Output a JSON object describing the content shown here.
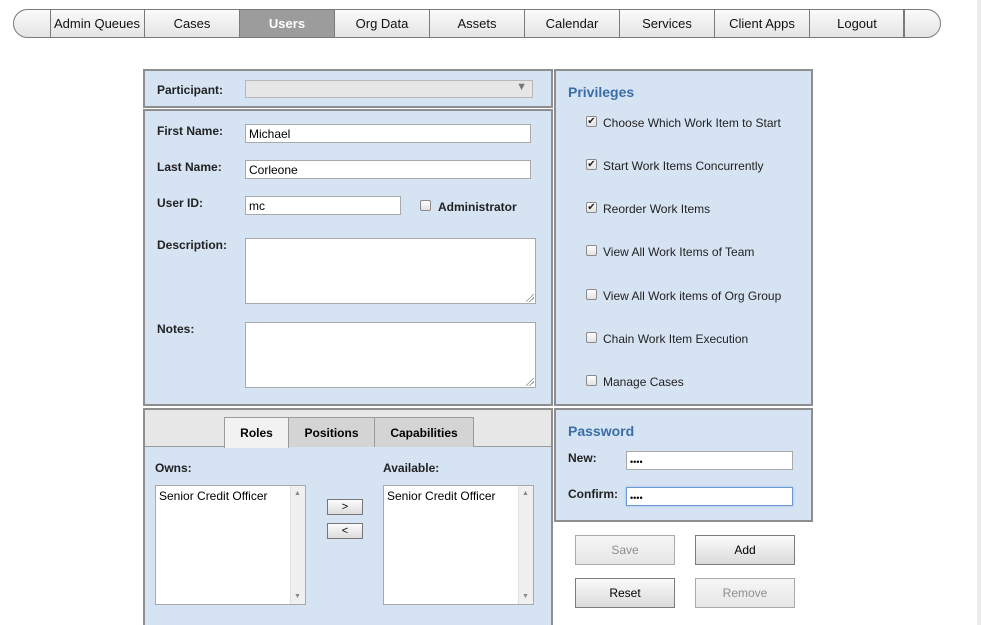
{
  "nav": {
    "items": [
      {
        "label": "Admin Queues",
        "active": false
      },
      {
        "label": "Cases",
        "active": false
      },
      {
        "label": "Users",
        "active": true
      },
      {
        "label": "Org Data",
        "active": false
      },
      {
        "label": "Assets",
        "active": false
      },
      {
        "label": "Calendar",
        "active": false
      },
      {
        "label": "Services",
        "active": false
      },
      {
        "label": "Client Apps",
        "active": false
      },
      {
        "label": "Logout",
        "active": false
      }
    ]
  },
  "participant": {
    "label": "Participant:",
    "value": ""
  },
  "user_form": {
    "first_name": {
      "label": "First Name:",
      "value": "Michael"
    },
    "last_name": {
      "label": "Last Name:",
      "value": "Corleone"
    },
    "user_id": {
      "label": "User ID:",
      "value": "mc"
    },
    "administrator": {
      "label": "Administrator",
      "checked": false
    },
    "description": {
      "label": "Description:",
      "value": ""
    },
    "notes": {
      "label": "Notes:",
      "value": ""
    }
  },
  "privileges": {
    "title": "Privileges",
    "items": [
      {
        "label": "Choose Which Work Item to Start",
        "checked": true
      },
      {
        "label": "Start Work Items Concurrently",
        "checked": true
      },
      {
        "label": "Reorder Work Items",
        "checked": true
      },
      {
        "label": "View All Work Items of Team",
        "checked": false
      },
      {
        "label": "View All Work items of Org Group",
        "checked": false
      },
      {
        "label": "Chain Work Item Execution",
        "checked": false
      },
      {
        "label": "Manage Cases",
        "checked": false
      }
    ]
  },
  "tabs": {
    "items": [
      {
        "label": "Roles",
        "active": true
      },
      {
        "label": "Positions",
        "active": false
      },
      {
        "label": "Capabilities",
        "active": false
      }
    ],
    "owns_label": "Owns:",
    "available_label": "Available:",
    "owns": [
      "Senior Credit Officer"
    ],
    "available": [
      "Senior Credit Officer"
    ],
    "move_right": ">",
    "move_left": "<"
  },
  "password": {
    "title": "Password",
    "new_label": "New:",
    "new_value": "••••",
    "confirm_label": "Confirm:",
    "confirm_value": "••••"
  },
  "actions": {
    "save": "Save",
    "add": "Add",
    "reset": "Reset",
    "remove": "Remove"
  }
}
